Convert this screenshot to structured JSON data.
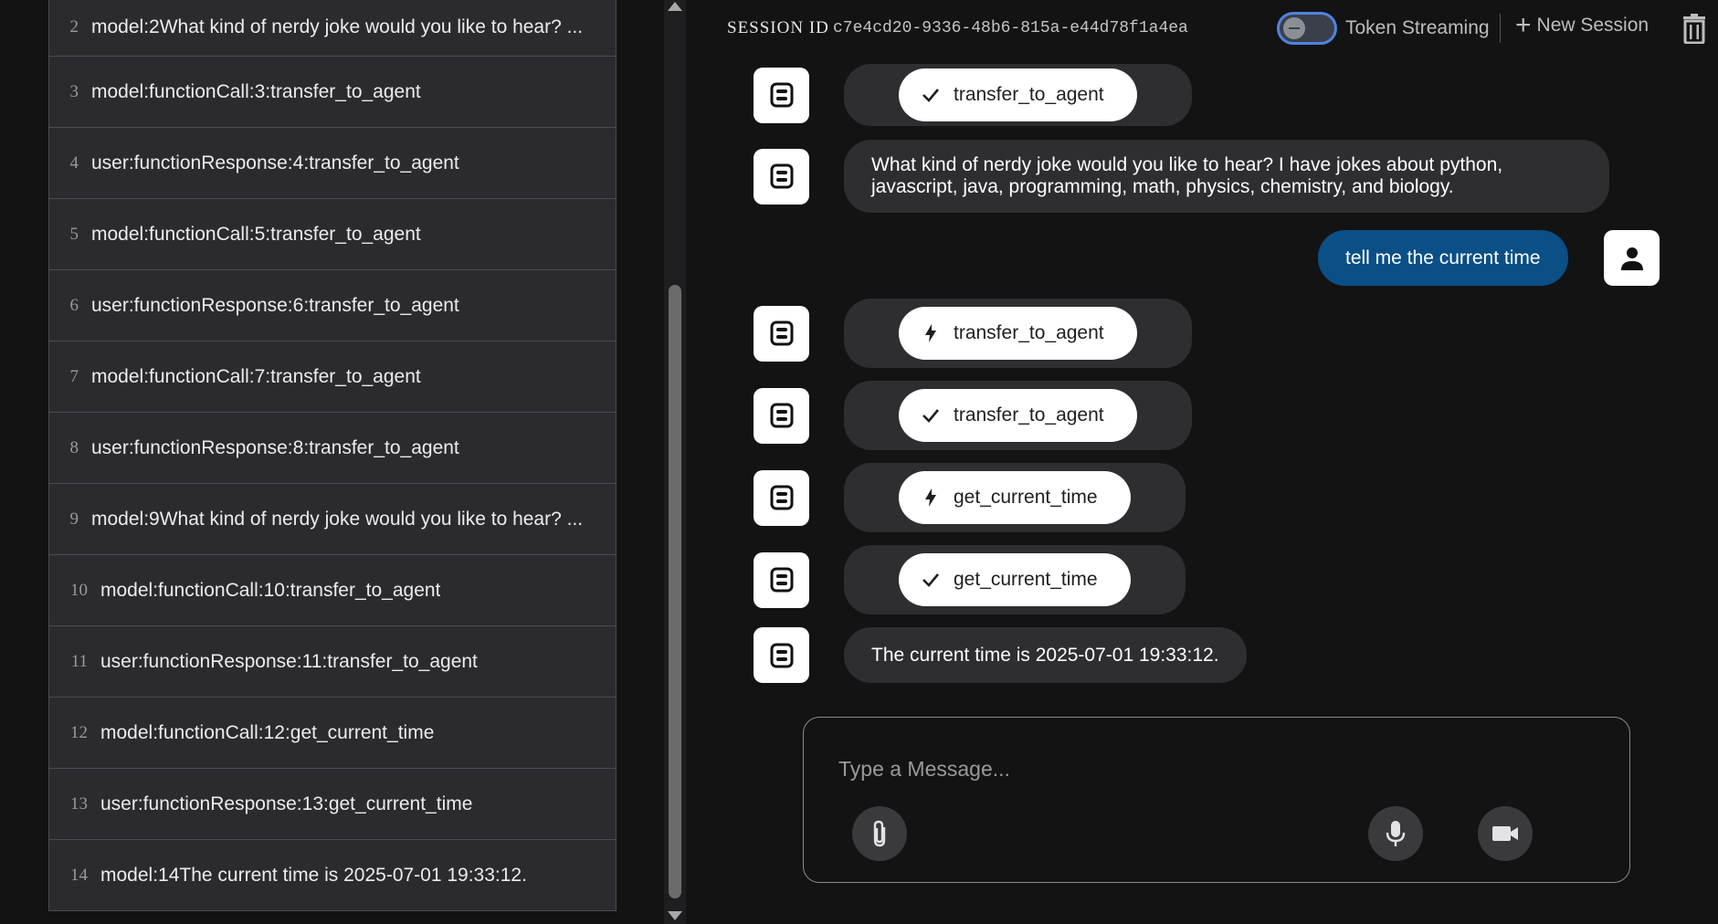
{
  "events": [
    {
      "num": "2",
      "text": "model:2What kind of nerdy joke would you like to hear? ..."
    },
    {
      "num": "3",
      "text": "model:functionCall:3:transfer_to_agent"
    },
    {
      "num": "4",
      "text": "user:functionResponse:4:transfer_to_agent"
    },
    {
      "num": "5",
      "text": "model:functionCall:5:transfer_to_agent"
    },
    {
      "num": "6",
      "text": "user:functionResponse:6:transfer_to_agent"
    },
    {
      "num": "7",
      "text": "model:functionCall:7:transfer_to_agent"
    },
    {
      "num": "8",
      "text": "user:functionResponse:8:transfer_to_agent"
    },
    {
      "num": "9",
      "text": "model:9What kind of nerdy joke would you like to hear? ..."
    },
    {
      "num": "10",
      "text": "model:functionCall:10:transfer_to_agent"
    },
    {
      "num": "11",
      "text": "user:functionResponse:11:transfer_to_agent"
    },
    {
      "num": "12",
      "text": "model:functionCall:12:get_current_time"
    },
    {
      "num": "13",
      "text": "user:functionResponse:13:get_current_time"
    },
    {
      "num": "14",
      "text": "model:14The current time is 2025-07-01 19:33:12."
    }
  ],
  "header": {
    "session_label": "SESSION ID",
    "session_id": "c7e4cd20-9336-48b6-815a-e44d78f1a4ea",
    "streaming_label": "Token Streaming",
    "streaming_enabled": false,
    "new_session_label": "New Session",
    "plus_icon": "+"
  },
  "messages": {
    "m1": {
      "icon": "check-icon",
      "label": "transfer_to_agent"
    },
    "m2": {
      "text": "What kind of nerdy joke would you like to hear? I have jokes about python, javascript, java, programming, math, physics, chemistry, and biology."
    },
    "m3": {
      "text": "tell me the current time"
    },
    "m4": {
      "icon": "bolt-icon",
      "label": "transfer_to_agent"
    },
    "m5": {
      "icon": "check-icon",
      "label": "transfer_to_agent"
    },
    "m6": {
      "icon": "bolt-icon",
      "label": "get_current_time"
    },
    "m7": {
      "icon": "check-icon",
      "label": "get_current_time"
    },
    "m8": {
      "text": "The current time is 2025-07-01 19:33:12."
    }
  },
  "composer": {
    "placeholder": "Type a Message..."
  },
  "colors": {
    "background": "#131314",
    "user_bubble": "#0a4f86",
    "bot_bubble": "#2e2e31",
    "toggle_border": "#4f84e0"
  }
}
